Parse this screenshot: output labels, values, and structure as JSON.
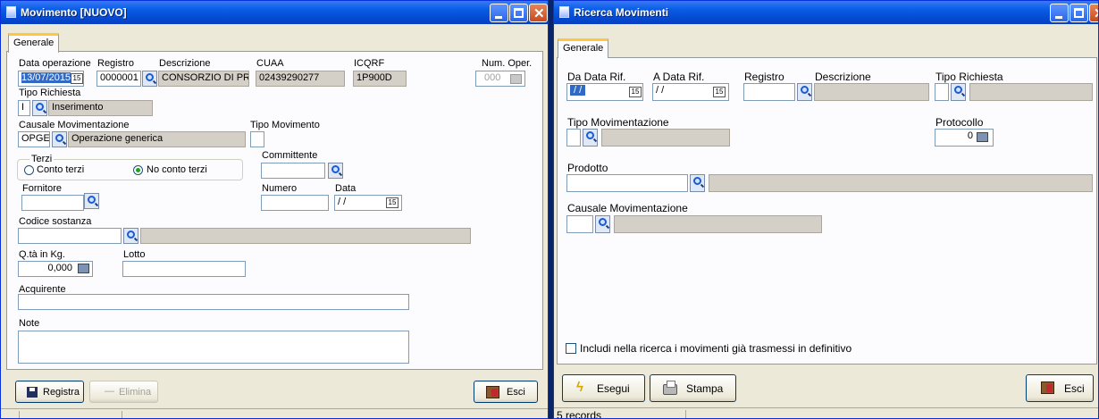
{
  "left_window": {
    "title": "Movimento  [NUOVO]",
    "tab": "Generale",
    "labels": {
      "data_operazione": "Data operazione",
      "registro": "Registro",
      "descrizione": "Descrizione",
      "cuaa": "CUAA",
      "icqrf": "ICQRF",
      "num_oper": "Num. Oper.",
      "tipo_richiesta": "Tipo Richiesta",
      "causale": "Causale Movimentazione",
      "tipo_movimento": "Tipo Movimento",
      "terzi": "Terzi",
      "committente": "Committente",
      "fornitore": "Fornitore",
      "numero": "Numero",
      "data": "Data",
      "codice_sostanza": "Codice sostanza",
      "qta": "Q.tà in Kg.",
      "lotto": "Lotto",
      "acquirente": "Acquirente",
      "note": "Note"
    },
    "values": {
      "data_operazione": "13/07/2015",
      "registro": "0000001",
      "descrizione": "CONSORZIO DI PROV",
      "cuaa": "02439290277",
      "icqrf": "1P900D",
      "num_oper": "000",
      "tipo_richiesta_code": "I",
      "tipo_richiesta_desc": "Inserimento",
      "causale_code": "OPGE",
      "causale_desc": "Operazione generica",
      "data": "/ /",
      "qta": "0,000"
    },
    "radio": {
      "conto_terzi": "Conto terzi",
      "no_conto_terzi": "No conto terzi",
      "selected": "No conto terzi"
    },
    "buttons": {
      "registra": "Registra",
      "elimina": "Elimina",
      "esci": "Esci"
    }
  },
  "right_window": {
    "title": "Ricerca Movimenti",
    "tab": "Generale",
    "labels": {
      "da_data": "Da Data Rif.",
      "a_data": "A Data Rif.",
      "registro": "Registro",
      "descrizione": "Descrizione",
      "tipo_richiesta": "Tipo Richiesta",
      "tipo_movimentazione": "Tipo Movimentazione",
      "protocollo": "Protocollo",
      "prodotto": "Prodotto",
      "causale": "Causale Movimentazione",
      "includi": "Includi nella ricerca i movimenti già trasmessi in definitivo"
    },
    "values": {
      "da_data": "/ /",
      "a_data": "/ /",
      "protocollo": "0"
    },
    "buttons": {
      "esegui": "Esegui",
      "stampa": "Stampa",
      "esci": "Esci"
    },
    "status": "5 records"
  },
  "colors": {
    "titlebar": "#0a5ee6",
    "window_bg": "#ece9d8",
    "selection": "#316ac5",
    "background": "#2f8a3a"
  }
}
